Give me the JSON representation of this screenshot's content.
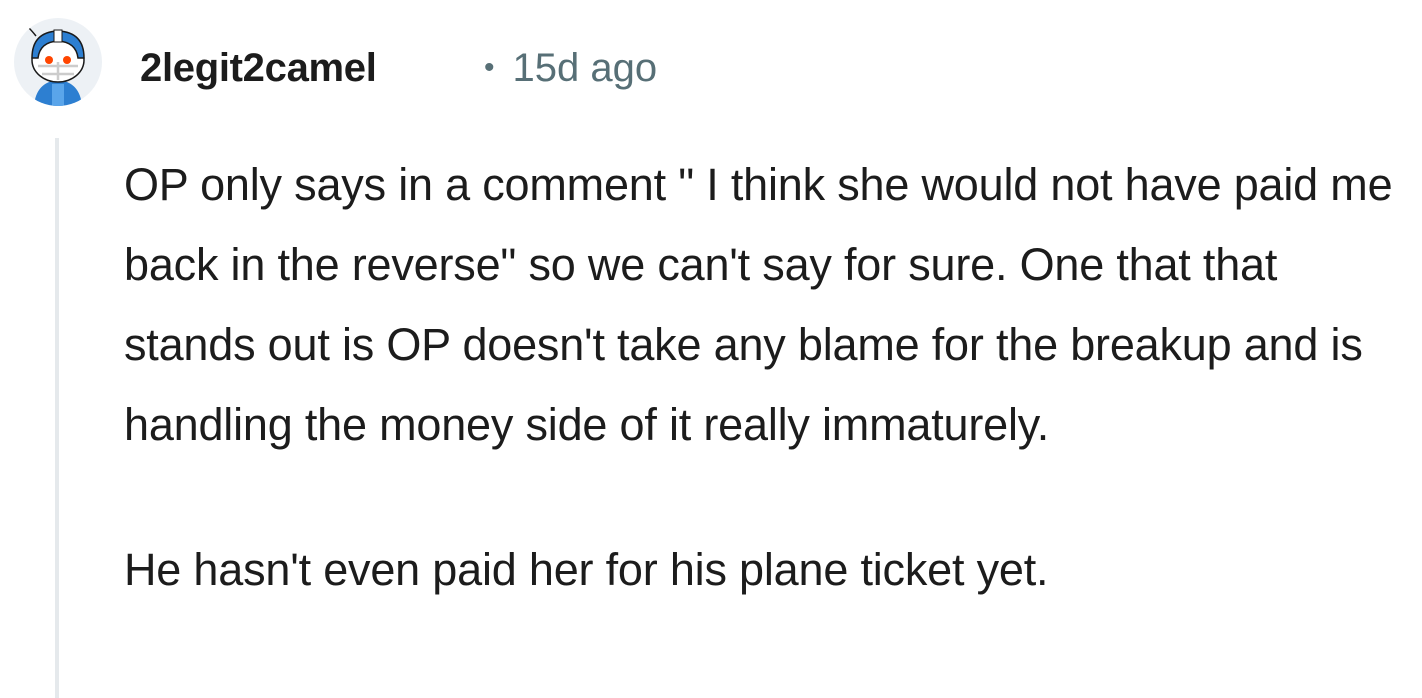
{
  "comment": {
    "username": "2legit2camel",
    "separator": "•",
    "timestamp": "15d ago",
    "paragraphs": [
      "OP only says in a comment \" I think she would not have paid me back in the reverse\" so we can't say for sure. One that that stands out is OP doesn't take any blame for the breakup and is handling the money side of it really immaturely.",
      "He hasn't even paid her for his plane ticket yet."
    ],
    "avatar_icon": "snoo-football-helmet-icon"
  },
  "colors": {
    "text": "#1c1c1c",
    "meta": "#576f76",
    "thread_line": "#e5e9ec",
    "avatar_bg": "#edf1f5",
    "helmet_blue": "#2d7fd1"
  }
}
